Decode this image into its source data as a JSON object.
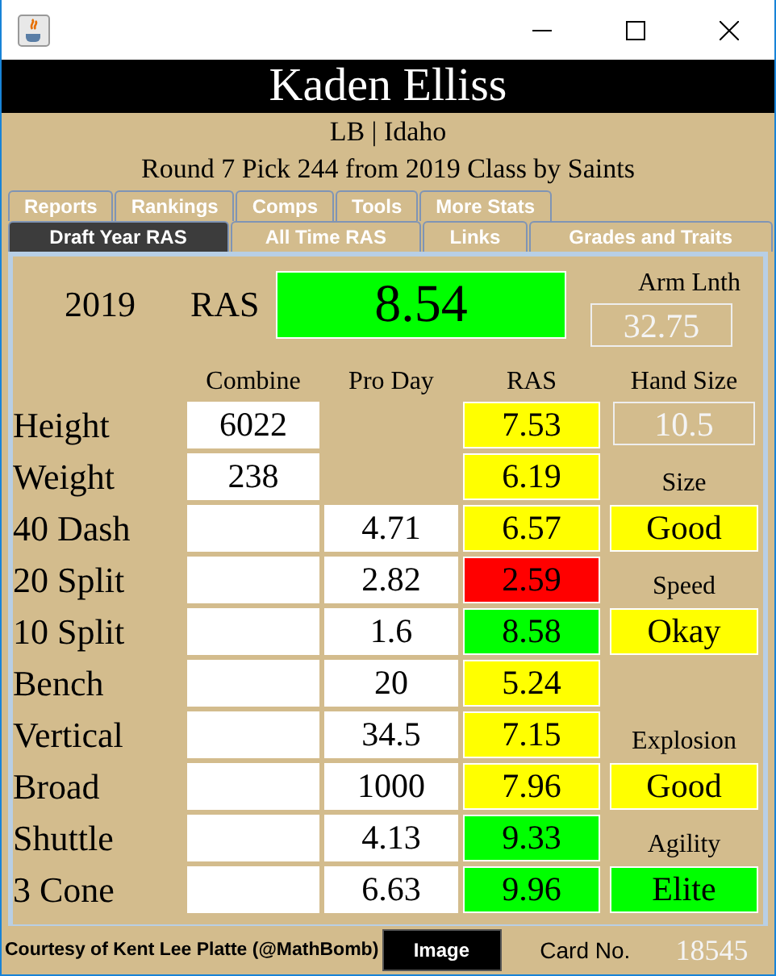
{
  "player": {
    "name": "Kaden Elliss",
    "position_school": "LB | Idaho",
    "draft": "Round 7 Pick 244 from 2019 Class by Saints"
  },
  "tabs_top": [
    {
      "label": "Reports",
      "selected": false
    },
    {
      "label": "Rankings",
      "selected": false
    },
    {
      "label": "Comps",
      "selected": false
    },
    {
      "label": "Tools",
      "selected": false
    },
    {
      "label": "More Stats",
      "selected": false
    }
  ],
  "tabs_bottom": [
    {
      "label": "Draft Year RAS",
      "selected": true
    },
    {
      "label": "All Time RAS",
      "selected": false
    },
    {
      "label": "Links",
      "selected": false
    },
    {
      "label": "Grades and Traits",
      "selected": false
    }
  ],
  "summary": {
    "year": "2019",
    "ras_label": "RAS",
    "ras_value": "8.54",
    "color": "#00ff00",
    "arm_label": "Arm Lnth",
    "arm_value": "32.75"
  },
  "columns": [
    "Combine",
    "Pro Day",
    "RAS",
    "Hand Size"
  ],
  "rows": [
    {
      "name": "Height",
      "combine": "6022",
      "pro_day": "",
      "ras": "7.53",
      "color": "#ffff00",
      "side": {
        "kind": "readout",
        "text": "10.5"
      }
    },
    {
      "name": "Weight",
      "combine": "238",
      "pro_day": "",
      "ras": "6.19",
      "color": "#ffff00",
      "side": {
        "kind": "label",
        "text": "Size"
      }
    },
    {
      "name": "40 Dash",
      "combine": "",
      "pro_day": "4.71",
      "ras": "6.57",
      "color": "#ffff00",
      "side": {
        "kind": "grade",
        "text": "Good",
        "color": "#ffff00"
      }
    },
    {
      "name": "20 Split",
      "combine": "",
      "pro_day": "2.82",
      "ras": "2.59",
      "color": "#ff0000",
      "side": {
        "kind": "label",
        "text": "Speed"
      }
    },
    {
      "name": "10 Split",
      "combine": "",
      "pro_day": "1.6",
      "ras": "8.58",
      "color": "#00ff00",
      "side": {
        "kind": "grade",
        "text": "Okay",
        "color": "#ffff00"
      }
    },
    {
      "name": "Bench",
      "combine": "",
      "pro_day": "20",
      "ras": "5.24",
      "color": "#ffff00",
      "side": {
        "kind": "empty"
      }
    },
    {
      "name": "Vertical",
      "combine": "",
      "pro_day": "34.5",
      "ras": "7.15",
      "color": "#ffff00",
      "side": {
        "kind": "label",
        "text": "Explosion"
      }
    },
    {
      "name": "Broad",
      "combine": "",
      "pro_day": "1000",
      "ras": "7.96",
      "color": "#ffff00",
      "side": {
        "kind": "grade",
        "text": "Good",
        "color": "#ffff00"
      }
    },
    {
      "name": "Shuttle",
      "combine": "",
      "pro_day": "4.13",
      "ras": "9.33",
      "color": "#00ff00",
      "side": {
        "kind": "label",
        "text": "Agility"
      }
    },
    {
      "name": "3 Cone",
      "combine": "",
      "pro_day": "6.63",
      "ras": "9.96",
      "color": "#00ff00",
      "side": {
        "kind": "grade",
        "text": "Elite",
        "color": "#00ff00"
      }
    }
  ],
  "footer": {
    "credit": "Courtesy of Kent Lee Platte (@MathBomb)",
    "button": "Image",
    "card_label": "Card No.",
    "card_number": "18545"
  }
}
